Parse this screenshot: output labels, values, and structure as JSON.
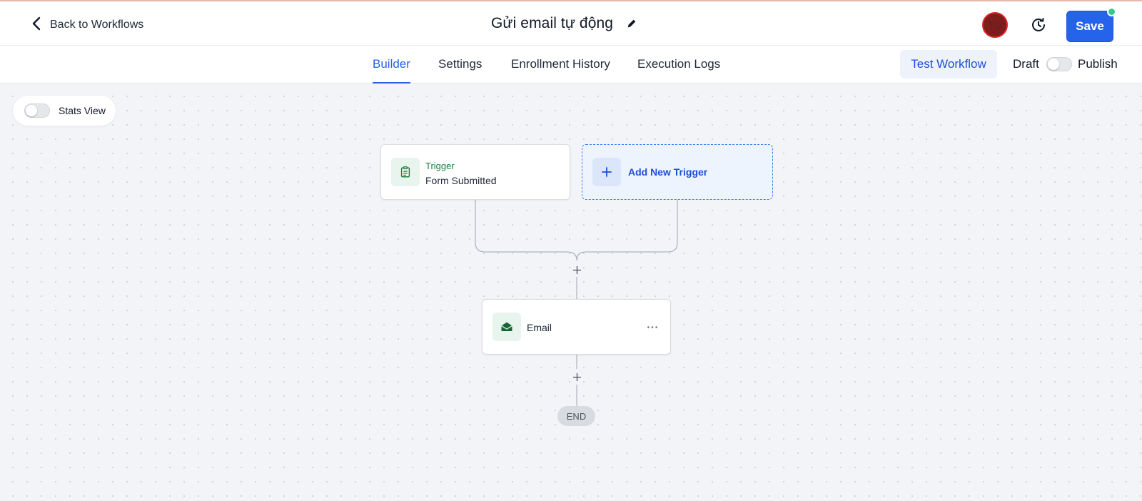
{
  "header": {
    "back_label": "Back to Workflows",
    "title": "Gửi email tự động",
    "avatar_initials": "TQ",
    "save_label": "Save"
  },
  "tabs": [
    {
      "label": "Builder",
      "active": true
    },
    {
      "label": "Settings",
      "active": false
    },
    {
      "label": "Enrollment History",
      "active": false
    },
    {
      "label": "Execution Logs",
      "active": false
    }
  ],
  "actions": {
    "test_label": "Test Workflow",
    "draft_label": "Draft",
    "publish_label": "Publish",
    "publish_toggle_on": false
  },
  "canvas": {
    "stats_view_label": "Stats View",
    "stats_view_on": false,
    "trigger": {
      "title": "Trigger",
      "subtitle": "Form Submitted",
      "icon": "clipboard-icon"
    },
    "add_trigger_label": "Add New Trigger",
    "action": {
      "label": "Email",
      "icon": "envelope-open-icon"
    },
    "end_label": "END"
  },
  "colors": {
    "primary": "#2563eb",
    "trigger_green": "#15803d",
    "canvas_bg": "#f3f4f7",
    "avatar_bg": "#7f1d1d",
    "status_dot": "#34c98a"
  }
}
